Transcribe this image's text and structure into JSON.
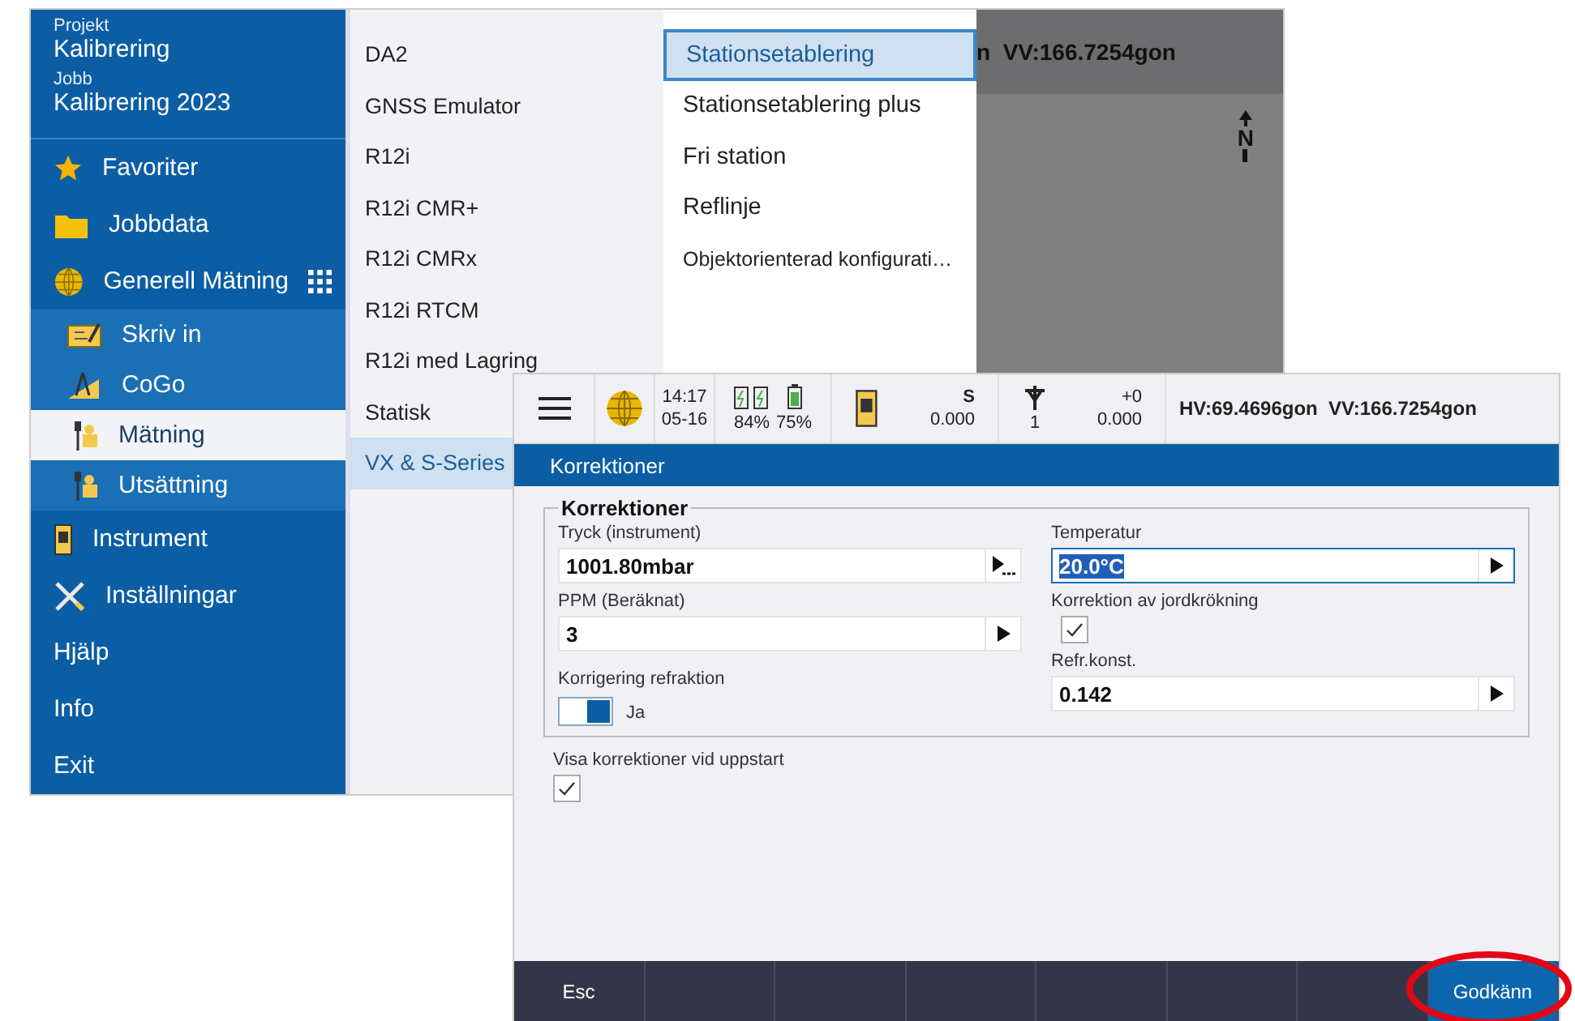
{
  "menu_screen": {
    "sidebar": {
      "project_label": "Projekt",
      "project": "Kalibrering",
      "job_label": "Jobb",
      "job": "Kalibrering 2023",
      "items": [
        {
          "label": "Favoriter",
          "selected": false
        },
        {
          "label": "Jobbdata",
          "selected": false
        },
        {
          "label": "Generell Mätning",
          "selected": false,
          "expanded": true,
          "children": [
            {
              "label": "Skriv in",
              "selected": false
            },
            {
              "label": "CoGo",
              "selected": false
            },
            {
              "label": "Mätning",
              "selected": true
            },
            {
              "label": "Utsättning",
              "selected": false
            }
          ]
        },
        {
          "label": "Instrument",
          "selected": false
        },
        {
          "label": "Inställningar",
          "selected": false
        },
        {
          "label": "Hjälp",
          "selected": false
        },
        {
          "label": "Info",
          "selected": false
        },
        {
          "label": "Exit",
          "selected": false
        }
      ]
    },
    "instrument_menu": [
      {
        "label": "DA2",
        "selected": false
      },
      {
        "label": "GNSS Emulator",
        "selected": false
      },
      {
        "label": "R12i",
        "selected": false
      },
      {
        "label": "R12i CMR+",
        "selected": false
      },
      {
        "label": "R12i CMRx",
        "selected": false
      },
      {
        "label": "R12i RTCM",
        "selected": false
      },
      {
        "label": "R12i med Lagring",
        "selected": false
      },
      {
        "label": "Statisk",
        "selected": false
      },
      {
        "label": "VX & S-Series",
        "selected": true
      }
    ],
    "function_menu": [
      {
        "label": "Stationsetablering",
        "selected": true
      },
      {
        "label": "Stationsetablering plus",
        "selected": false
      },
      {
        "label": "Fri station",
        "selected": false
      },
      {
        "label": "Reflinje",
        "selected": false
      },
      {
        "label": "Objektorienterad konfigurati…",
        "selected": false
      }
    ],
    "map": {
      "status_text": "n  VV:166.7254gon",
      "north_label": "N"
    }
  },
  "dialog_screen": {
    "status_bar": {
      "time": "14:17",
      "date": "05-16",
      "battery_1": "84%",
      "battery_2": "75%",
      "instrument_code": "S",
      "instrument_value": "0.000",
      "target_number": "1",
      "target_offset": "+0",
      "target_value": "0.000",
      "angles": "HV:69.4696gon  VV:166.7254gon"
    },
    "title": "Korrektioner",
    "group_title": "Korrektioner",
    "left_fields": [
      {
        "kind": "input",
        "label": "Tryck (instrument)",
        "value": "1001.80mbar",
        "more_options": true,
        "focused": false
      },
      {
        "kind": "input",
        "label": "PPM (Beräknat)",
        "value": "3",
        "more_options": false,
        "focused": false
      },
      {
        "kind": "toggle",
        "label": "Korrigering refraktion",
        "on": true,
        "text": "Ja"
      }
    ],
    "right_fields": [
      {
        "kind": "input",
        "label": "Temperatur",
        "value": "20.0°C",
        "more_options": false,
        "focused": true
      },
      {
        "kind": "checkbox",
        "label": "Korrektion av jordkrökning",
        "checked": true
      },
      {
        "kind": "input",
        "label": "Refr.konst.",
        "value": "0.142",
        "more_options": false,
        "focused": false
      }
    ],
    "startup_option": {
      "label": "Visa korrektioner vid uppstart",
      "checked": true
    },
    "softkeys": [
      {
        "label": "Esc",
        "primary": false,
        "highlighted": false
      },
      {
        "label": "Godkänn",
        "primary": true,
        "highlighted": true
      }
    ]
  }
}
